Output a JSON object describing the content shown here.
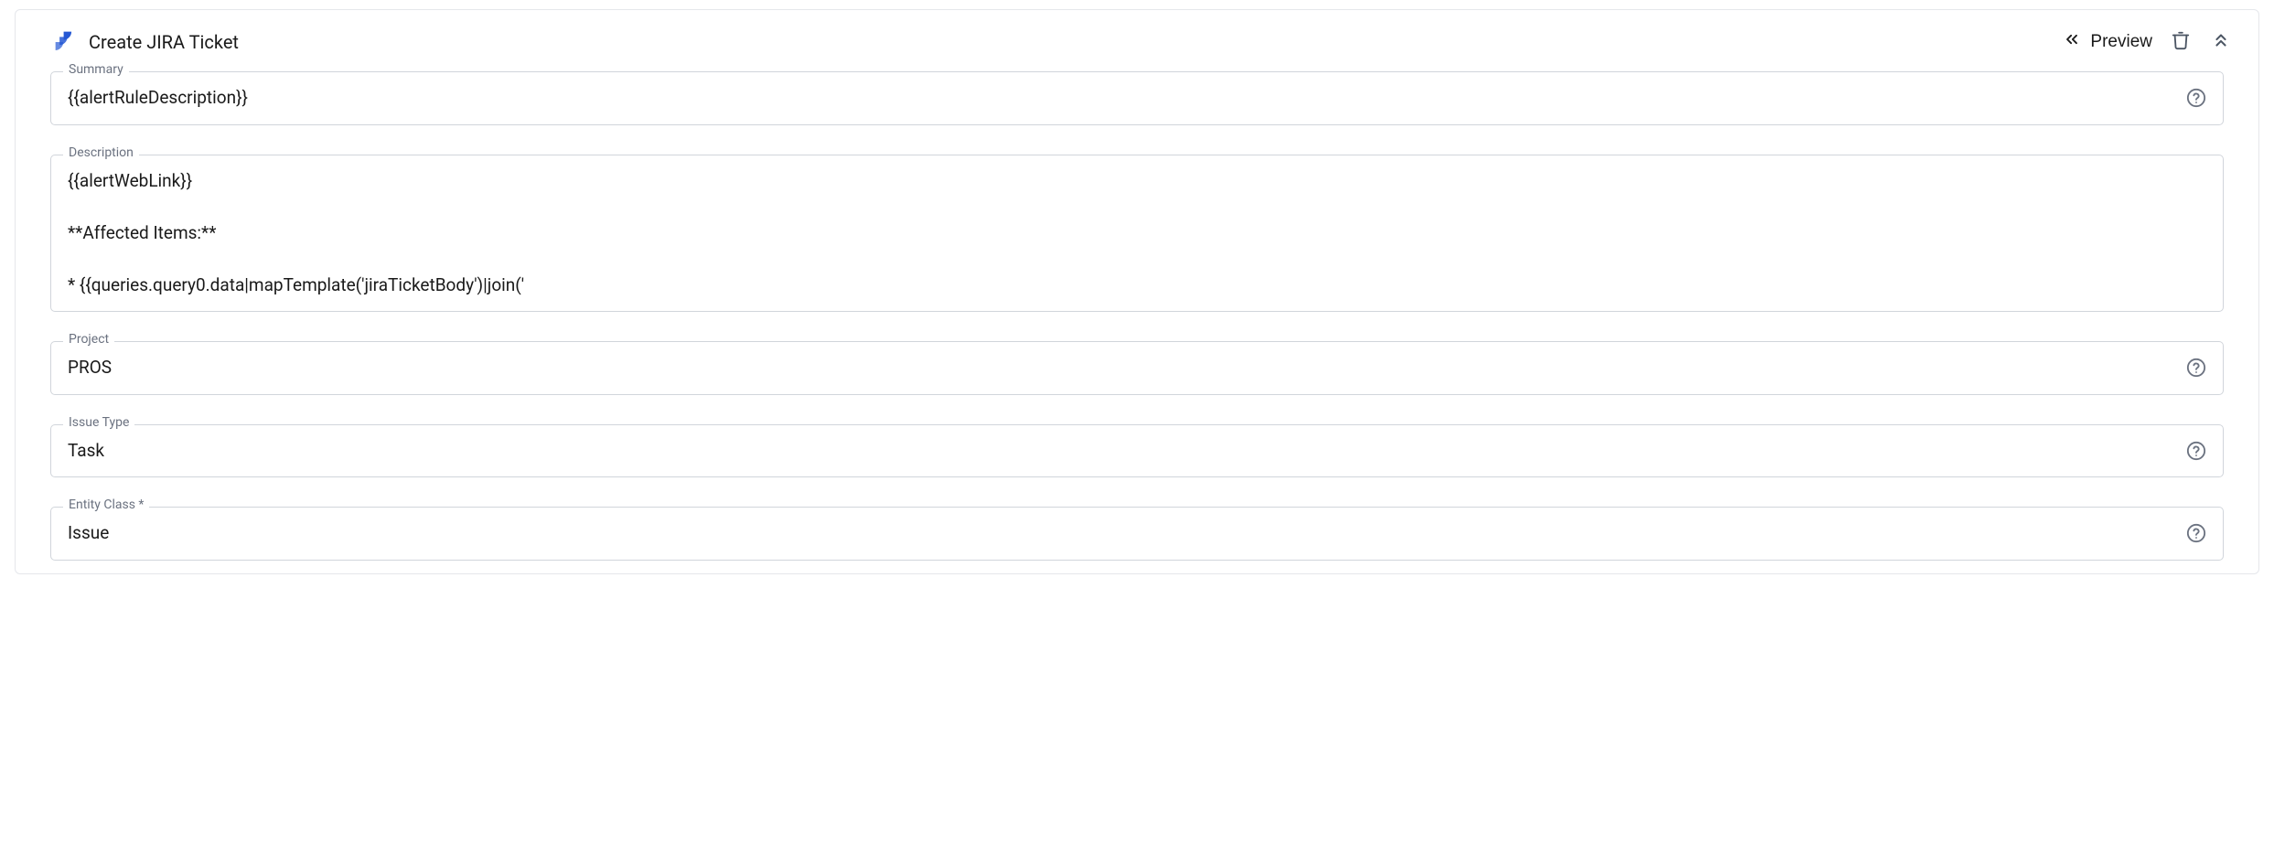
{
  "header": {
    "title": "Create JIRA Ticket",
    "preview_label": "Preview"
  },
  "fields": {
    "summary": {
      "label": "Summary",
      "value": "{{alertRuleDescription}}"
    },
    "description": {
      "label": "Description",
      "value": "{{alertWebLink}}\n\n**Affected Items:**\n\n* {{queries.query0.data|mapTemplate('jiraTicketBody')|join('"
    },
    "project": {
      "label": "Project",
      "value": "PROS"
    },
    "issueType": {
      "label": "Issue Type",
      "value": "Task"
    },
    "entityClass": {
      "label": "Entity Class *",
      "value": "Issue"
    }
  }
}
